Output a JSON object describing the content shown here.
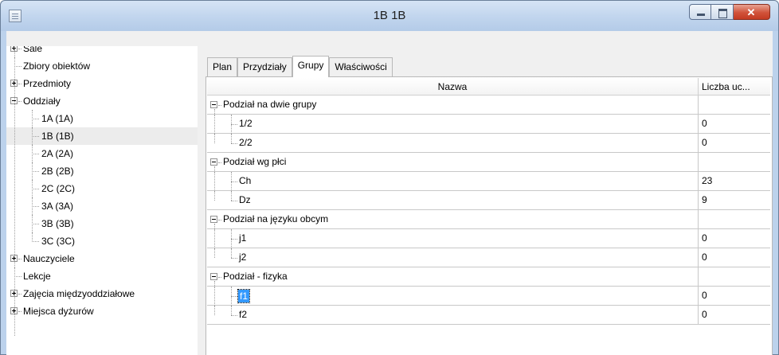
{
  "window": {
    "title": "1B 1B"
  },
  "tree": {
    "items": [
      {
        "label": "Sale",
        "expander": "plus",
        "level": 0
      },
      {
        "label": "Zbiory obiektów",
        "expander": "none",
        "level": 0
      },
      {
        "label": "Przedmioty",
        "expander": "plus",
        "level": 0
      },
      {
        "label": "Oddziały",
        "expander": "minus",
        "level": 0
      },
      {
        "label": "1A (1A)",
        "expander": "none",
        "level": 1
      },
      {
        "label": "1B (1B)",
        "expander": "none",
        "level": 1,
        "selected": true
      },
      {
        "label": "2A (2A)",
        "expander": "none",
        "level": 1
      },
      {
        "label": "2B (2B)",
        "expander": "none",
        "level": 1
      },
      {
        "label": "2C (2C)",
        "expander": "none",
        "level": 1
      },
      {
        "label": "3A (3A)",
        "expander": "none",
        "level": 1
      },
      {
        "label": "3B (3B)",
        "expander": "none",
        "level": 1
      },
      {
        "label": "3C (3C)",
        "expander": "none",
        "level": 1
      },
      {
        "label": "Nauczyciele",
        "expander": "plus",
        "level": 0
      },
      {
        "label": "Lekcje",
        "expander": "none",
        "level": 0
      },
      {
        "label": "Zajęcia międzyoddziałowe",
        "expander": "plus",
        "level": 0
      },
      {
        "label": "Miejsca dyżurów",
        "expander": "plus",
        "level": 0
      }
    ]
  },
  "tabs": [
    {
      "label": "Plan"
    },
    {
      "label": "Przydziały"
    },
    {
      "label": "Grupy",
      "active": true
    },
    {
      "label": "Właściwości"
    }
  ],
  "grid": {
    "columns": [
      "Nazwa",
      "Liczba uc..."
    ],
    "rows": [
      {
        "name": "Podział na dwie grupy",
        "value": "",
        "group": true
      },
      {
        "name": "1/2",
        "value": "0"
      },
      {
        "name": "2/2",
        "value": "0",
        "last": true
      },
      {
        "name": "Podział wg płci",
        "value": "",
        "group": true
      },
      {
        "name": "Ch",
        "value": "23"
      },
      {
        "name": "Dz",
        "value": "9",
        "last": true
      },
      {
        "name": "Podział na języku obcym",
        "value": "",
        "group": true
      },
      {
        "name": "j1",
        "value": "0"
      },
      {
        "name": "j2",
        "value": "0",
        "last": true
      },
      {
        "name": "Podział - fizyka",
        "value": "",
        "group": true
      },
      {
        "name": "f1",
        "value": "0",
        "selected": true
      },
      {
        "name": "f2",
        "value": "0",
        "last": true
      }
    ]
  }
}
